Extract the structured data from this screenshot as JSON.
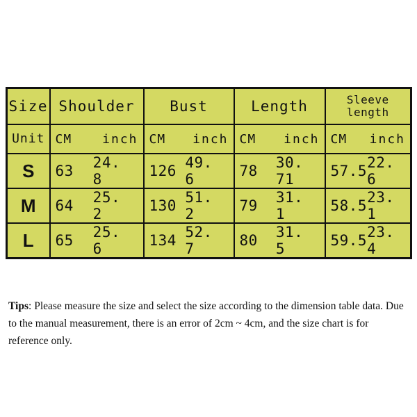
{
  "table": {
    "background_color": "#d4d962",
    "border_color": "#111111",
    "columns": [
      {
        "key": "size",
        "label": "Size",
        "two_line": false
      },
      {
        "key": "should",
        "label": "Shoulder",
        "two_line": false
      },
      {
        "key": "bust",
        "label": "Bust",
        "two_line": false
      },
      {
        "key": "length",
        "label": "Length",
        "two_line": false
      },
      {
        "key": "sleeve",
        "label": "Sleeve\nlength",
        "two_line": true
      }
    ],
    "unit_row": {
      "label": "Unit",
      "cm": "CM",
      "inch": "inch"
    },
    "rows": [
      {
        "size": "S",
        "shoulder_cm": "63",
        "shoulder_inch": "24. 8",
        "bust_cm": "126",
        "bust_inch": "49. 6",
        "length_cm": "78",
        "length_inch": "30. 71",
        "sleeve_cm": "57.5",
        "sleeve_inch": "22. 6"
      },
      {
        "size": "M",
        "shoulder_cm": "64",
        "shoulder_inch": "25. 2",
        "bust_cm": "130",
        "bust_inch": "51. 2",
        "length_cm": "79",
        "length_inch": "31. 1",
        "sleeve_cm": "58.5",
        "sleeve_inch": "23. 1"
      },
      {
        "size": "L",
        "shoulder_cm": "65",
        "shoulder_inch": "25. 6",
        "bust_cm": "134",
        "bust_inch": "52. 7",
        "length_cm": "80",
        "length_inch": "31. 5",
        "sleeve_cm": "59.5",
        "sleeve_inch": "23. 4"
      }
    ]
  },
  "tips": {
    "label": "Tips",
    "separator": ": ",
    "text": "Please measure the size and select the size according to the dimension table data. Due to the manual measurement, there is an error of 2cm ~ 4cm, and the size chart is for reference only."
  },
  "chart_data": {
    "type": "table",
    "title": "Size Chart",
    "categories": [
      "S",
      "M",
      "L"
    ],
    "units": [
      "CM",
      "inch"
    ],
    "measurements": [
      "Shoulder",
      "Bust",
      "Length",
      "Sleeve length"
    ],
    "series": [
      {
        "name": "Shoulder CM",
        "values": [
          63,
          64,
          65
        ]
      },
      {
        "name": "Shoulder inch",
        "values": [
          24.8,
          25.2,
          25.6
        ]
      },
      {
        "name": "Bust CM",
        "values": [
          126,
          130,
          134
        ]
      },
      {
        "name": "Bust inch",
        "values": [
          49.6,
          51.2,
          52.7
        ]
      },
      {
        "name": "Length CM",
        "values": [
          78,
          79,
          80
        ]
      },
      {
        "name": "Length inch",
        "values": [
          30.71,
          31.1,
          31.5
        ]
      },
      {
        "name": "Sleeve length CM",
        "values": [
          57.5,
          58.5,
          59.5
        ]
      },
      {
        "name": "Sleeve length inch",
        "values": [
          22.6,
          23.1,
          23.4
        ]
      }
    ],
    "xlabel": "Size",
    "ylabel": "",
    "grid": true,
    "legend": "none"
  }
}
